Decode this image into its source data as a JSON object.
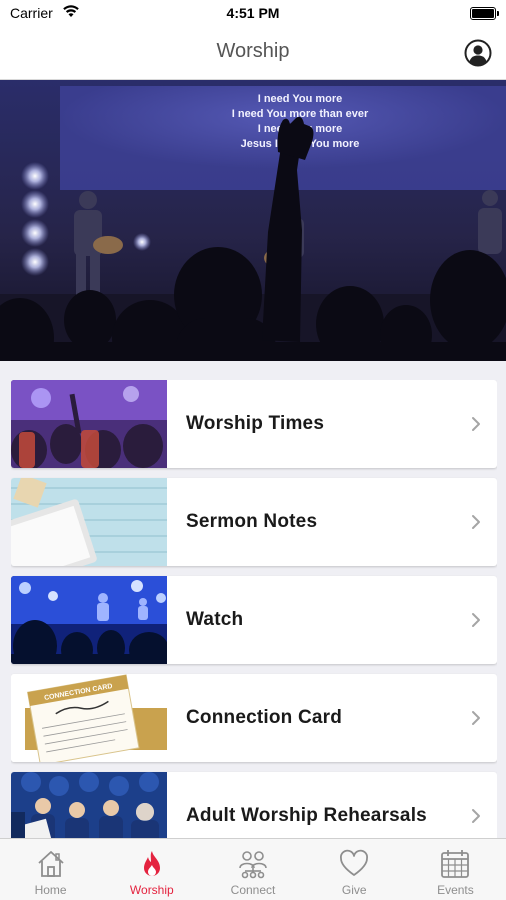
{
  "status_bar": {
    "carrier": "Carrier",
    "time": "4:51 PM"
  },
  "nav": {
    "title": "Worship"
  },
  "hero": {
    "lyrics": [
      "I need You more",
      "I need You more than ever",
      "I need You more",
      "Jesus I need You more"
    ]
  },
  "menu": [
    {
      "label": "Worship Times"
    },
    {
      "label": "Sermon Notes"
    },
    {
      "label": "Watch"
    },
    {
      "label": "Connection Card",
      "thumb_text": "CONNECTION CARD"
    },
    {
      "label": "Adult Worship Rehearsals"
    }
  ],
  "tabs": [
    {
      "label": "Home",
      "icon": "home-icon"
    },
    {
      "label": "Worship",
      "icon": "flame-icon",
      "active": true
    },
    {
      "label": "Connect",
      "icon": "people-icon"
    },
    {
      "label": "Give",
      "icon": "heart-icon"
    },
    {
      "label": "Events",
      "icon": "calendar-icon"
    }
  ],
  "colors": {
    "accent": "#e4233f",
    "inactive": "#8e8e8e"
  }
}
